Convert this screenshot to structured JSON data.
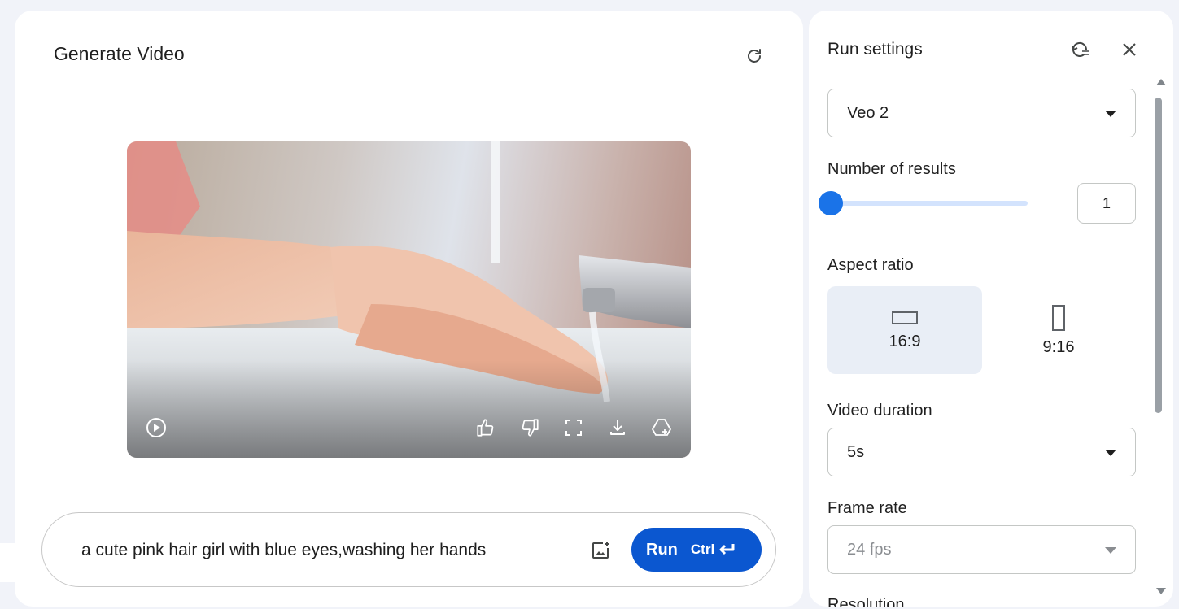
{
  "main": {
    "title": "Generate Video",
    "prompt": "a cute pink hair girl with blue eyes,washing her hands",
    "run_label": "Run",
    "run_shortcut": "Ctrl"
  },
  "video": {
    "controls": [
      "play-icon",
      "thumbs-up-icon",
      "thumbs-down-icon",
      "fullscreen-icon",
      "download-icon",
      "drive-save-icon"
    ]
  },
  "settings": {
    "title": "Run settings",
    "model": "Veo 2",
    "number_of_results_label": "Number of results",
    "number_of_results": "1",
    "aspect_ratio_label": "Aspect ratio",
    "aspect_ratios": [
      {
        "label": "16:9",
        "selected": true
      },
      {
        "label": "9:16",
        "selected": false
      }
    ],
    "video_duration_label": "Video duration",
    "video_duration": "5s",
    "frame_rate_label": "Frame rate",
    "frame_rate": "24 fps",
    "resolution_label": "Resolution"
  },
  "colors": {
    "accent": "#0b57d0",
    "slider": "#1a73e8",
    "selected_bg": "#e9eef6",
    "page_bg": "#f1f3f9"
  }
}
